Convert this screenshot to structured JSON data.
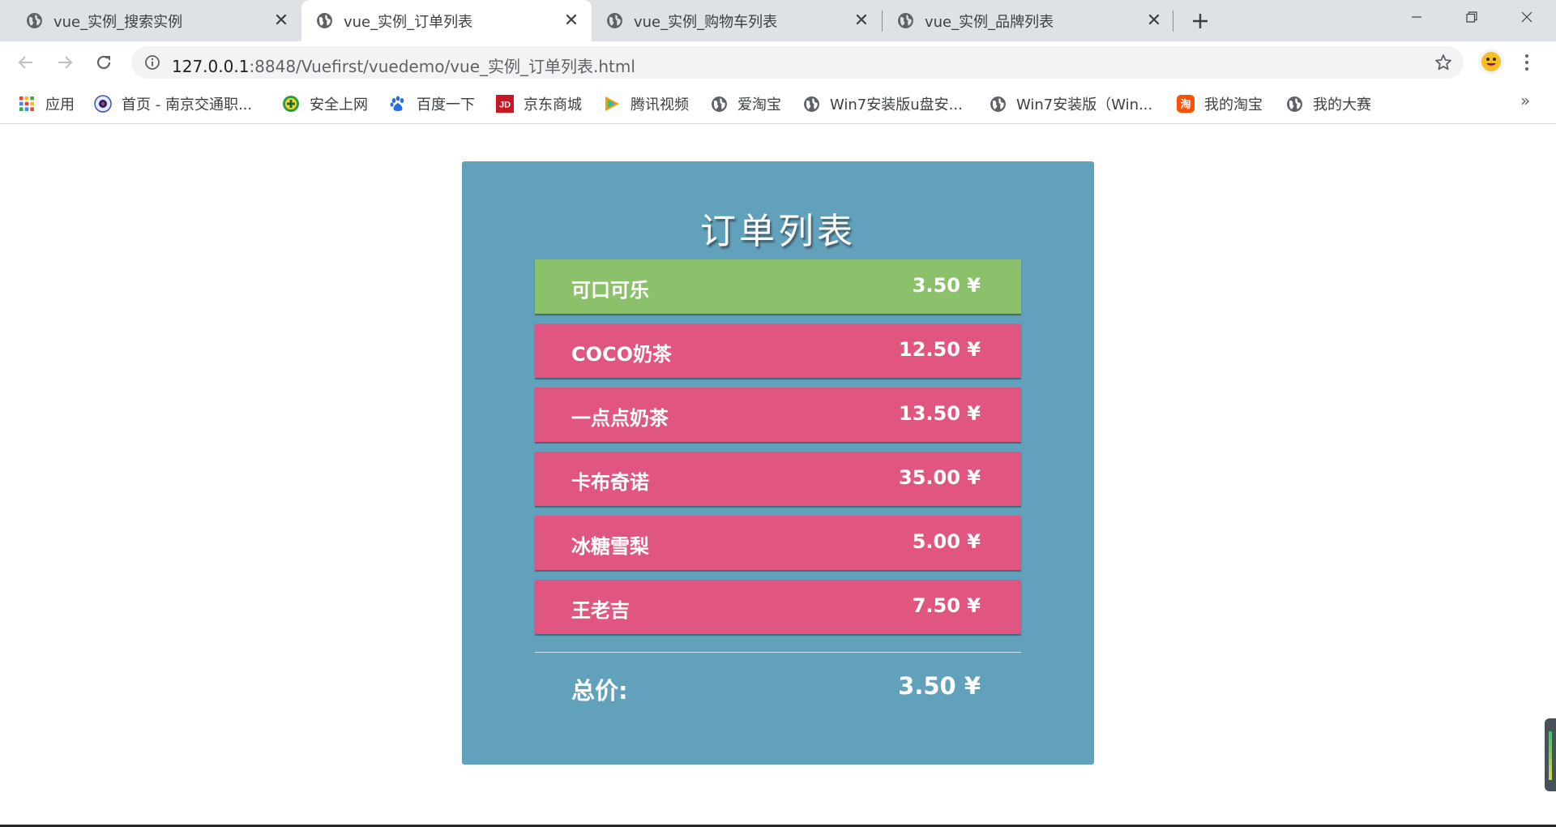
{
  "browser": {
    "tabs": [
      {
        "title": "vue_实例_搜索实例",
        "active": false
      },
      {
        "title": "vue_实例_订单列表",
        "active": true
      },
      {
        "title": "vue_实例_购物车列表",
        "active": false
      },
      {
        "title": "vue_实例_品牌列表",
        "active": false
      }
    ],
    "new_tab_icon": "plus-icon",
    "address": {
      "host": "127.0.0.1",
      "rest": ":8848/Vuefirst/vuedemo/vue_实例_订单列表.html"
    },
    "bookmarks": [
      {
        "label": "应用",
        "icon": "apps-grid-icon"
      },
      {
        "label": "首页 - 南京交通职...",
        "icon": "school-seal-icon"
      },
      {
        "label": "安全上网",
        "icon": "shield-plus-icon"
      },
      {
        "label": "百度一下",
        "icon": "baidu-paw-icon"
      },
      {
        "label": "京东商城",
        "icon": "jd-icon"
      },
      {
        "label": "腾讯视频",
        "icon": "play-icon"
      },
      {
        "label": "爱淘宝",
        "icon": "globe-icon"
      },
      {
        "label": "Win7安装版u盘安...",
        "icon": "globe-icon"
      },
      {
        "label": "Win7安装版（Win...",
        "icon": "globe-icon"
      },
      {
        "label": "我的淘宝",
        "icon": "taobao-icon"
      },
      {
        "label": "我的大赛",
        "icon": "globe-icon"
      }
    ],
    "bookmarks_more": "»"
  },
  "order_list": {
    "title": "订单列表",
    "items": [
      {
        "name": "可口可乐",
        "price": "3.50 ¥",
        "selected": true
      },
      {
        "name": "COCO奶茶",
        "price": "12.50 ¥",
        "selected": false
      },
      {
        "name": "一点点奶茶",
        "price": "13.50 ¥",
        "selected": false
      },
      {
        "name": "卡布奇诺",
        "price": "35.00 ¥",
        "selected": false
      },
      {
        "name": "冰糖雪梨",
        "price": "5.00 ¥",
        "selected": false
      },
      {
        "name": "王老吉",
        "price": "7.50 ¥",
        "selected": false
      }
    ],
    "total_label": "总价:",
    "total_value": "3.50 ¥"
  },
  "colors": {
    "panel": "#61a1bc",
    "item_default": "#e15681",
    "item_selected": "#8cc16c"
  }
}
